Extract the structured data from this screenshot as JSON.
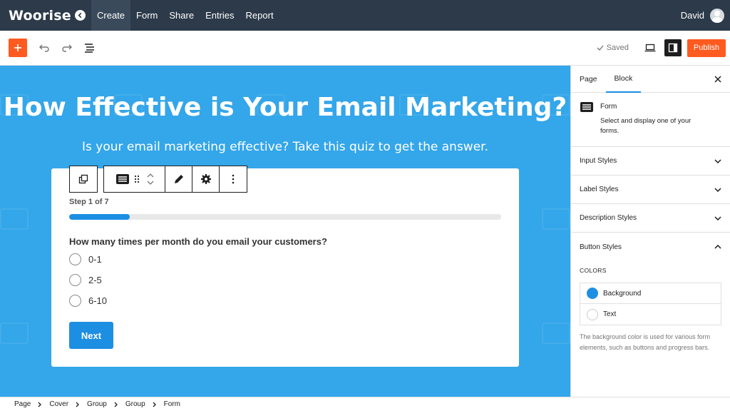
{
  "topnav": {
    "logo": "Woorise",
    "tabs": [
      {
        "label": "Create",
        "active": true
      },
      {
        "label": "Form"
      },
      {
        "label": "Share"
      },
      {
        "label": "Entries"
      },
      {
        "label": "Report"
      }
    ],
    "user_name": "David"
  },
  "toolbar": {
    "saved_label": "Saved",
    "publish_label": "Publish"
  },
  "canvas": {
    "title": "How Effective is Your Email Marketing?",
    "subtitle": "Is your email marketing effective? Take this quiz to get the answer.",
    "form": {
      "step_label": "Step 1 of 7",
      "progress_percent": 14,
      "question": "How many times per month do you email your customers?",
      "options": [
        "0-1",
        "2-5",
        "6-10"
      ],
      "next_label": "Next"
    }
  },
  "panel": {
    "tabs": [
      "Page",
      "Block"
    ],
    "active_tab": "Block",
    "block_name": "Form",
    "block_desc": "Select and display one of your forms.",
    "sections": [
      "Input Styles",
      "Label Styles",
      "Description Styles",
      "Button Styles"
    ],
    "colors_title": "COLORS",
    "colors": [
      {
        "label": "Background",
        "value": "#1d8fe3"
      },
      {
        "label": "Text",
        "value": "#ffffff"
      }
    ],
    "colors_help": "The background color is used for various form elements, such as buttons and progress bars."
  },
  "breadcrumb": [
    "Page",
    "Cover",
    "Group",
    "Group",
    "Form"
  ],
  "colors": {
    "accent": "#ff5a1f",
    "primary": "#1d8fe3",
    "canvas_bg": "#34a6ea",
    "nav_bg": "#2c3a4a"
  }
}
